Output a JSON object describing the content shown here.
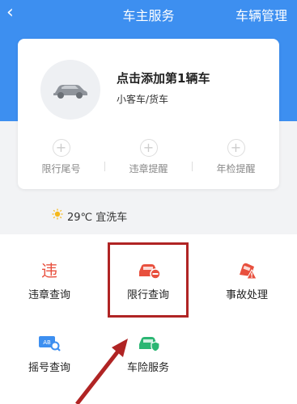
{
  "header": {
    "back_icon": "chevron-left-icon",
    "title": "车主服务",
    "right_link": "车辆管理"
  },
  "card": {
    "car_icon": "car-icon",
    "add_title": "点击添加第1辆车",
    "add_subtitle": "小客车/货车",
    "reminders": [
      {
        "label": "限行尾号"
      },
      {
        "label": "违章提醒"
      },
      {
        "label": "年检提醒"
      }
    ]
  },
  "weather": {
    "icon": "sun-icon",
    "text": "29℃ 宜洗车"
  },
  "services": [
    {
      "label": "违章查询",
      "icon": "violation-icon"
    },
    {
      "label": "限行查询",
      "icon": "car-restriction-icon"
    },
    {
      "label": "事故处理",
      "icon": "accident-icon"
    },
    {
      "label": "摇号查询",
      "icon": "lottery-search-icon"
    },
    {
      "label": "车险服务",
      "icon": "car-insurance-icon"
    }
  ],
  "colors": {
    "header_blue": "#3d8ff0",
    "icon_red": "#e8503e",
    "icon_green": "#2bb673",
    "icon_blue": "#3d8ff0",
    "annotation_red": "#b02424"
  }
}
